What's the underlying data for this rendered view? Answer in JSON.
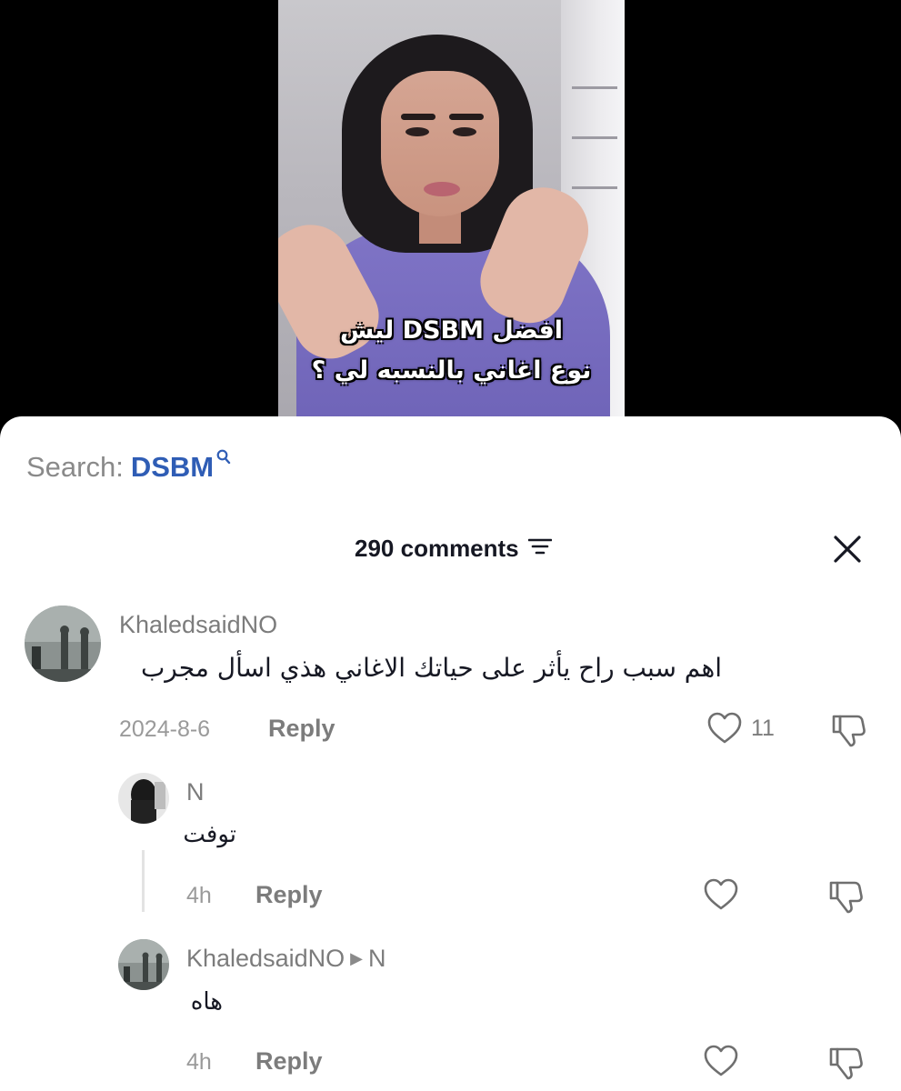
{
  "video": {
    "caption_line1": "ليش DSBM افضل",
    "caption_line2": "نوع اغاني بالنسبه لي ؟"
  },
  "search": {
    "label": "Search:",
    "term": "DSBM",
    "icon": "search-icon"
  },
  "header": {
    "count_label": "290 comments",
    "filter_icon": "filter-icon",
    "close_icon": "close-icon"
  },
  "comments": [
    {
      "username": "KhaledsaidNO",
      "text": "اهم سبب راح يأثر على حياتك الاغاني هذي اسأل مجرب",
      "date": "2024-8-6",
      "reply_label": "Reply",
      "likes": "11"
    }
  ],
  "replies": [
    {
      "username": "N",
      "text": "توفت",
      "date": "4h",
      "reply_label": "Reply"
    },
    {
      "username": "KhaledsaidNO",
      "reply_to": "N",
      "text": "هاه",
      "date": "4h",
      "reply_label": "Reply"
    }
  ],
  "colors": {
    "link_blue": "#2f5db5",
    "muted_text": "#7c7c7c",
    "primary_text": "#161823"
  }
}
